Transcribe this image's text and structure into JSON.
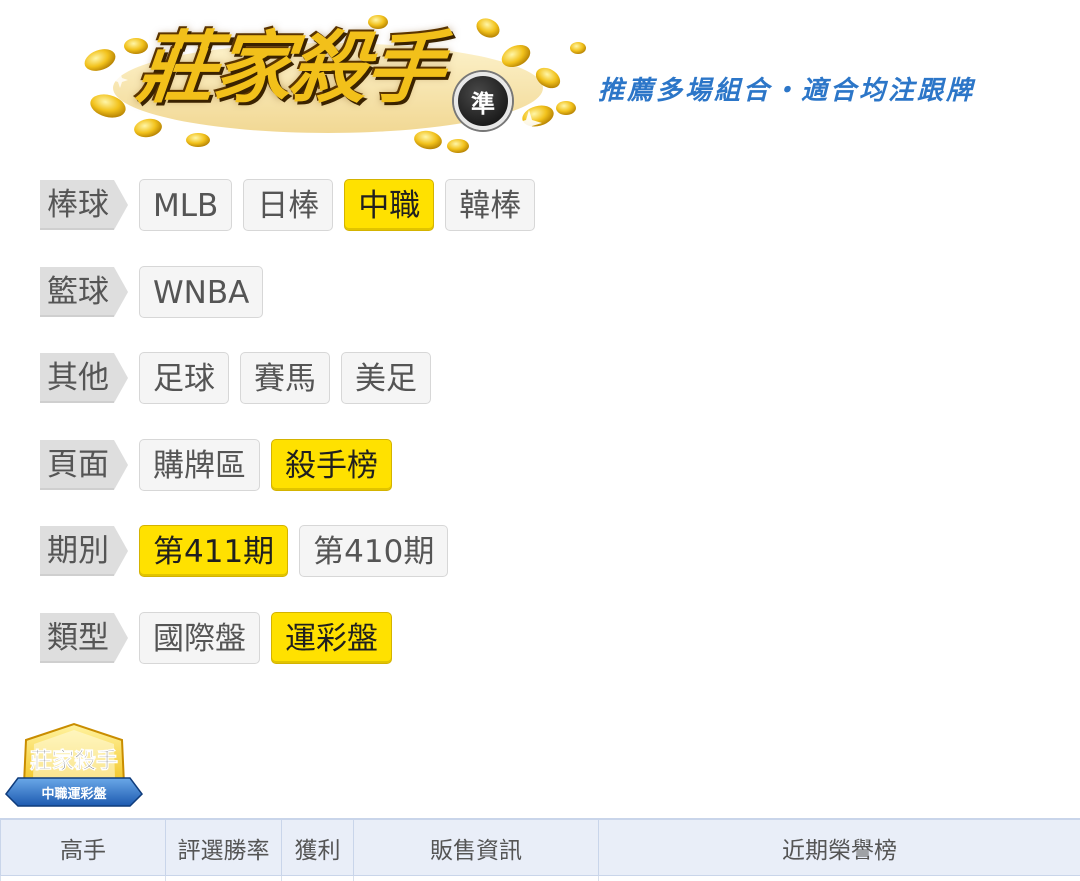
{
  "header": {
    "logo_text": "莊家殺手",
    "logo_badge": "準",
    "slogan": "推薦多場組合・適合均注跟牌"
  },
  "filters": [
    {
      "label": "棒球",
      "options": [
        {
          "text": "MLB",
          "active": false
        },
        {
          "text": "日棒",
          "active": false
        },
        {
          "text": "中職",
          "active": true
        },
        {
          "text": "韓棒",
          "active": false
        }
      ]
    },
    {
      "label": "籃球",
      "options": [
        {
          "text": "WNBA",
          "active": false
        }
      ]
    },
    {
      "label": "其他",
      "options": [
        {
          "text": "足球",
          "active": false
        },
        {
          "text": "賽馬",
          "active": false
        },
        {
          "text": "美足",
          "active": false
        }
      ]
    },
    {
      "label": "頁面",
      "options": [
        {
          "text": "購牌區",
          "active": false
        },
        {
          "text": "殺手榜",
          "active": true
        }
      ]
    },
    {
      "label": "期別",
      "options": [
        {
          "text": "第411期",
          "active": true
        },
        {
          "text": "第410期",
          "active": false
        }
      ]
    },
    {
      "label": "類型",
      "options": [
        {
          "text": "國際盤",
          "active": false
        },
        {
          "text": "運彩盤",
          "active": true
        }
      ]
    }
  ],
  "badge": {
    "title": "莊家殺手",
    "ribbon": "中職運彩盤"
  },
  "table": {
    "headers": [
      "高手",
      "評選勝率",
      "獲利",
      "販售資訊",
      "近期榮譽榜"
    ]
  },
  "colors": {
    "active": "#ffe100",
    "slogan": "#2c76c8",
    "table_header": "#e9eef8"
  }
}
